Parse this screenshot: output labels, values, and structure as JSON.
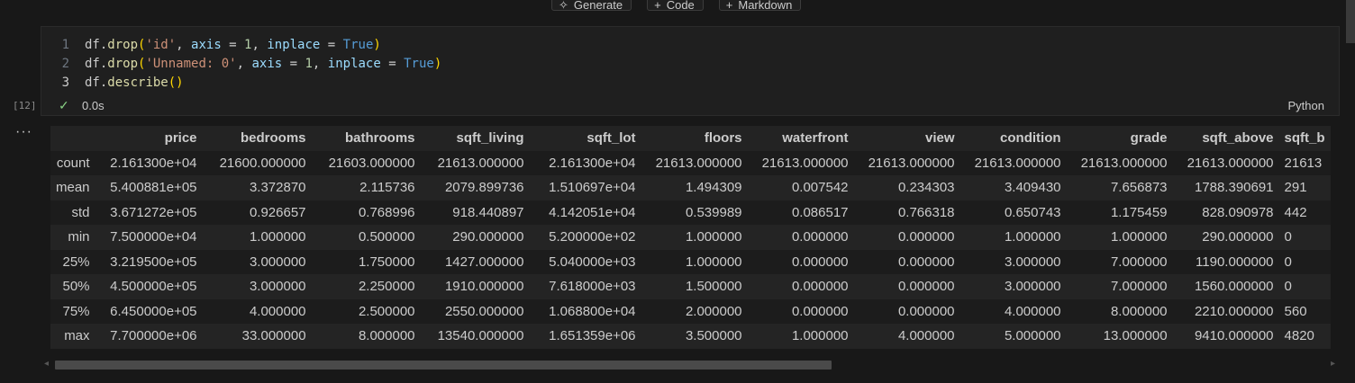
{
  "toolbar": {
    "generate_label": "Generate",
    "code_label": "Code",
    "markdown_label": "Markdown"
  },
  "cell": {
    "execution_count": "[12]",
    "language": "Python",
    "status_time": "0.0s",
    "lines": [
      {
        "num": "1"
      },
      {
        "num": "2"
      },
      {
        "num": "3"
      }
    ],
    "code": {
      "l1": {
        "a": "df",
        "b": ".",
        "c": "drop",
        "d": "(",
        "e": "'id'",
        "f": ", ",
        "g": "axis",
        "h": " = ",
        "i": "1",
        "j": ", ",
        "k": "inplace",
        "l": " = ",
        "m": "True",
        "n": ")"
      },
      "l2": {
        "a": "df",
        "b": ".",
        "c": "drop",
        "d": "(",
        "e": "'Unnamed: 0'",
        "f": ", ",
        "g": "axis",
        "h": " = ",
        "i": "1",
        "j": ", ",
        "k": "inplace",
        "l": " = ",
        "m": "True",
        "n": ")"
      },
      "l3": {
        "a": "df",
        "b": ".",
        "c": "describe",
        "d": "()"
      }
    }
  },
  "output": {
    "columns": [
      "",
      "price",
      "bedrooms",
      "bathrooms",
      "sqft_living",
      "sqft_lot",
      "floors",
      "waterfront",
      "view",
      "condition",
      "grade",
      "sqft_above",
      "sqft_b"
    ],
    "rows": [
      [
        "count",
        "2.161300e+04",
        "21600.000000",
        "21603.000000",
        "21613.000000",
        "2.161300e+04",
        "21613.000000",
        "21613.000000",
        "21613.000000",
        "21613.000000",
        "21613.000000",
        "21613.000000",
        "21613"
      ],
      [
        "mean",
        "5.400881e+05",
        "3.372870",
        "2.115736",
        "2079.899736",
        "1.510697e+04",
        "1.494309",
        "0.007542",
        "0.234303",
        "3.409430",
        "7.656873",
        "1788.390691",
        "291"
      ],
      [
        "std",
        "3.671272e+05",
        "0.926657",
        "0.768996",
        "918.440897",
        "4.142051e+04",
        "0.539989",
        "0.086517",
        "0.766318",
        "0.650743",
        "1.175459",
        "828.090978",
        "442"
      ],
      [
        "min",
        "7.500000e+04",
        "1.000000",
        "0.500000",
        "290.000000",
        "5.200000e+02",
        "1.000000",
        "0.000000",
        "0.000000",
        "1.000000",
        "1.000000",
        "290.000000",
        "0"
      ],
      [
        "25%",
        "3.219500e+05",
        "3.000000",
        "1.750000",
        "1427.000000",
        "5.040000e+03",
        "1.000000",
        "0.000000",
        "0.000000",
        "3.000000",
        "7.000000",
        "1190.000000",
        "0"
      ],
      [
        "50%",
        "4.500000e+05",
        "3.000000",
        "2.250000",
        "1910.000000",
        "7.618000e+03",
        "1.500000",
        "0.000000",
        "0.000000",
        "3.000000",
        "7.000000",
        "1560.000000",
        "0"
      ],
      [
        "75%",
        "6.450000e+05",
        "4.000000",
        "2.500000",
        "2550.000000",
        "1.068800e+04",
        "2.000000",
        "0.000000",
        "0.000000",
        "4.000000",
        "8.000000",
        "2210.000000",
        "560"
      ],
      [
        "max",
        "7.700000e+06",
        "33.000000",
        "8.000000",
        "13540.000000",
        "1.651359e+06",
        "3.500000",
        "1.000000",
        "4.000000",
        "5.000000",
        "13.000000",
        "9410.000000",
        "4820"
      ]
    ]
  }
}
